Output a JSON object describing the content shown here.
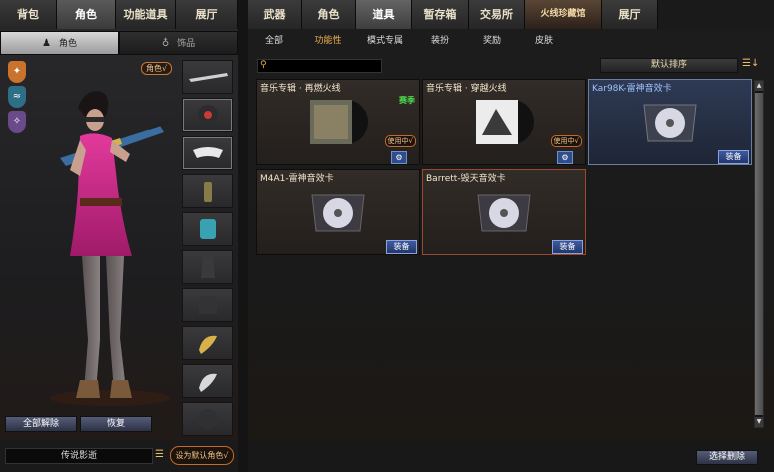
{
  "left_tabs": [
    {
      "label": "背包",
      "active": false
    },
    {
      "label": "角色",
      "active": true
    },
    {
      "label": "功能道具",
      "active": false
    },
    {
      "label": "展厅",
      "active": false
    }
  ],
  "left_subtabs": [
    {
      "label": "角色",
      "icon": "character-icon",
      "active": true
    },
    {
      "label": "饰品",
      "icon": "accessory-icon",
      "active": false
    }
  ],
  "role_badge": "角色√",
  "left_buttons": {
    "unequip_all": "全部解除",
    "restore": "恢复"
  },
  "character_name": "传说影逝",
  "set_default_button": "设为默认角色√",
  "right_tabs": [
    {
      "label": "武器",
      "active": false
    },
    {
      "label": "角色",
      "active": false
    },
    {
      "label": "道具",
      "active": true
    },
    {
      "label": "暂存箱",
      "active": false
    },
    {
      "label": "交易所",
      "active": false
    },
    {
      "label": "火线珍藏馆",
      "active": false
    },
    {
      "label": "展厅",
      "active": false
    }
  ],
  "right_subtabs": [
    {
      "label": "全部",
      "active": false
    },
    {
      "label": "功能性",
      "active": true
    },
    {
      "label": "模式专属",
      "active": false
    },
    {
      "label": "装扮",
      "active": false
    },
    {
      "label": "奖励",
      "active": false
    },
    {
      "label": "皮肤",
      "active": false
    }
  ],
  "search": {
    "placeholder": ""
  },
  "sort_label": "默认排序",
  "items": [
    {
      "title": "音乐专辑 · 再燃火线",
      "tag": "赛季",
      "status": "使用中√",
      "action": "gear",
      "style": "plain"
    },
    {
      "title": "音乐专辑 · 穿越火线",
      "tag": "",
      "status": "使用中√",
      "action": "gear",
      "style": "plain"
    },
    {
      "title": "Kar98K-雷神音效卡",
      "tag": "",
      "status": "",
      "action": "装备",
      "style": "blue"
    },
    {
      "title": "M4A1-雷神音效卡",
      "tag": "",
      "status": "",
      "action": "装备",
      "style": "plain"
    },
    {
      "title": "Barrett-毁天音效卡",
      "tag": "",
      "status": "",
      "action": "装备",
      "style": "orange"
    }
  ],
  "clear_button": "选择删除",
  "colors": {
    "accent_orange": "#c56a2a",
    "equip_blue": "#3d5aa2",
    "season_green": "#4cdc4c"
  }
}
